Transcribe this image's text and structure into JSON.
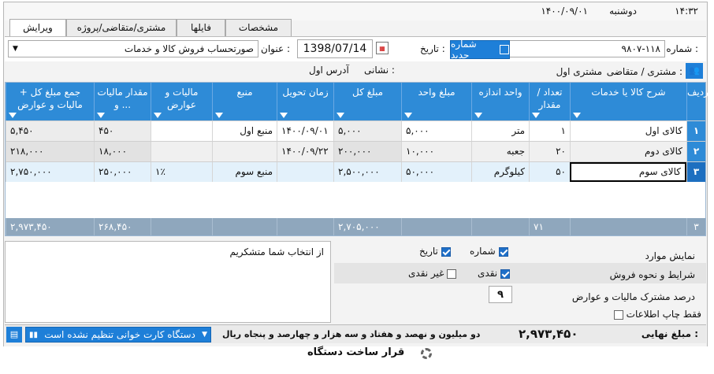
{
  "header": {
    "time": "۱۴:۳۲",
    "day": "دوشنبه",
    "date": "۱۴۰۰/۰۹/۰۱"
  },
  "tabs": [
    {
      "label": "ویرایش",
      "active": true
    },
    {
      "label": "مشتری/متقاضی/پروژه",
      "active": false
    },
    {
      "label": "فایلها",
      "active": false
    },
    {
      "label": "مشخصات",
      "active": false
    }
  ],
  "form": {
    "number_label": "شماره :",
    "number_value": "۹۸۰۷-۱۱۸",
    "new_number_button": "شماره جدید",
    "date_label": "تاریخ :",
    "date_value": "1398/07/14",
    "title_label": "عنوان :",
    "title_value": "صورتحساب فروش کالا و خدمات",
    "customer_label": "مشتری / متقاضی :",
    "customer_value": "مشتری اول",
    "address_label": "نشانی :",
    "address_value": "آدرس اول"
  },
  "grid": {
    "columns": [
      "ردیف",
      "شرح کالا یا خدمات",
      "تعداد / مقدار",
      "واحد اندازه",
      "مبلغ واحد",
      "مبلغ کل",
      "زمان تحویل",
      "منبع",
      "مالیات و عوارض",
      "مقدار مالیات و ...",
      "جمع مبلغ کل + مالیات و عوارض"
    ],
    "rows": [
      {
        "n": "۱",
        "desc": "کالای اول",
        "qty": "۱",
        "unit": "متر",
        "price": "۵,۰۰۰",
        "total": "۵,۰۰۰",
        "delivery": "۱۴۰۰/۰۹/۰۱",
        "source": "منبع اول",
        "tax_pct": "",
        "tax_amt": "۴۵۰",
        "grand": "۵,۴۵۰"
      },
      {
        "n": "۲",
        "desc": "کالای دوم",
        "qty": "۲۰",
        "unit": "جعبه",
        "price": "۱۰,۰۰۰",
        "total": "۲۰۰,۰۰۰",
        "delivery": "۱۴۰۰/۰۹/۲۲",
        "source": "",
        "tax_pct": "",
        "tax_amt": "۱۸,۰۰۰",
        "grand": "۲۱۸,۰۰۰"
      },
      {
        "n": "۳",
        "desc": "کالای سوم",
        "qty": "۵۰",
        "unit": "کیلوگرم",
        "price": "۵۰,۰۰۰",
        "total": "۲,۵۰۰,۰۰۰",
        "delivery": "",
        "source": "منبع سوم",
        "tax_pct": "۱٪",
        "tax_amt": "۲۵۰,۰۰۰",
        "grand": "۲,۷۵۰,۰۰۰"
      }
    ],
    "footer": {
      "n": "۳",
      "qty": "۷۱",
      "total": "۲,۷۰۵,۰۰۰",
      "tax_amt": "۲۶۸,۴۵۰",
      "grand": "۲,۹۷۳,۴۵۰"
    }
  },
  "notes_text": "از انتخاب شما متشکریم",
  "options": {
    "show_items_label": "نمایش موارد",
    "show_number": "شماره",
    "show_date": "تاریخ",
    "terms_label": "شرایط و نحوه فروش",
    "cash": "نقدی",
    "non_cash": "غیر نقدی",
    "tax_pct_label": "درصد مشترک مالیات و عوارض",
    "tax_pct_value": "۹",
    "print_only_label": "فقط چاپ اطلاعات"
  },
  "final": {
    "label": "مبلغ نهایی :",
    "value": "۲,۹۷۳,۴۵۰",
    "words": "دو میلیون و نهصد و هفتاد و سه هزار و چهارصد و پنجاه ریال",
    "card_reader": "دستگاه کارت خوانی تنظیم نشده است"
  },
  "torn_text": "قرار ساخت دستگاه"
}
